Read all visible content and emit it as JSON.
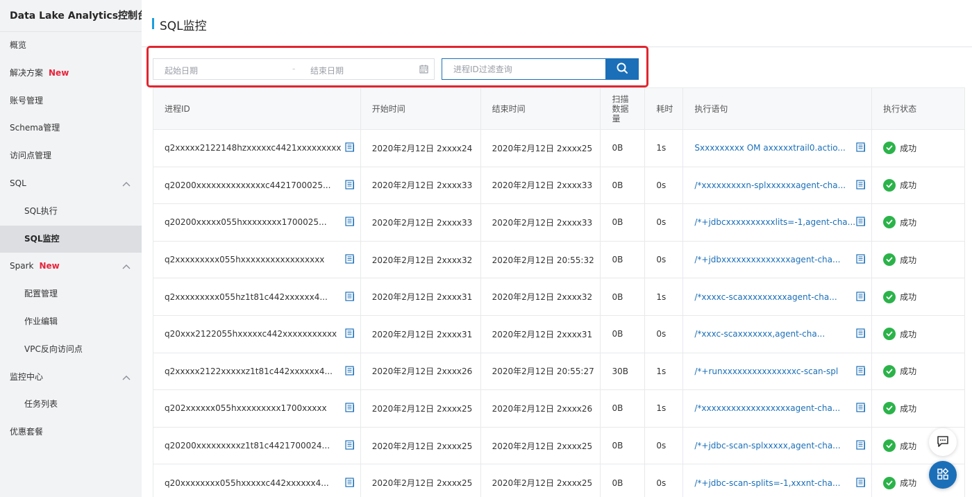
{
  "sidebar": {
    "title": "Data Lake Analytics控制台",
    "items": [
      {
        "label": "概览",
        "new": "",
        "chevron": false
      },
      {
        "label": "解决方案",
        "new": "New",
        "chevron": false
      },
      {
        "label": "账号管理",
        "new": "",
        "chevron": false
      },
      {
        "label": "Schema管理",
        "new": "",
        "chevron": false
      },
      {
        "label": "访问点管理",
        "new": "",
        "chevron": false
      },
      {
        "label": "SQL",
        "new": "",
        "chevron": true
      },
      {
        "label": "SQL执行",
        "new": "",
        "chevron": false,
        "sub": true
      },
      {
        "label": "SQL监控",
        "new": "",
        "chevron": false,
        "sub": true,
        "active": true
      },
      {
        "label": "Spark",
        "new": "New",
        "chevron": true
      },
      {
        "label": "配置管理",
        "new": "",
        "chevron": false,
        "sub": true
      },
      {
        "label": "作业编辑",
        "new": "",
        "chevron": false,
        "sub": true
      },
      {
        "label": "VPC反向访问点",
        "new": "",
        "chevron": false,
        "sub": true
      },
      {
        "label": "监控中心",
        "new": "",
        "chevron": true
      },
      {
        "label": "任务列表",
        "new": "",
        "chevron": false,
        "sub": true
      },
      {
        "label": "优惠套餐",
        "new": "",
        "chevron": false
      }
    ]
  },
  "page": {
    "title": "SQL监控"
  },
  "filters": {
    "start_placeholder": "起始日期",
    "separator": "-",
    "end_placeholder": "结束日期",
    "search_placeholder": "进程ID过滤查询"
  },
  "table": {
    "columns": [
      "进程ID",
      "开始时间",
      "结束时间",
      "扫描数据量",
      "耗时",
      "执行语句",
      "执行状态"
    ],
    "rows": [
      {
        "id": "q2xxxxx2122148hzxxxxxc4421xxxxxxxxx",
        "start": "2020年2月12日 2xxxx24",
        "end": "2020年2月12日 2xxxx25",
        "scan": "0B",
        "dur": "1s",
        "sql": "Sxxxxxxxxx OM axxxxxtrail0.actio...",
        "status": "成功"
      },
      {
        "id": "q20200xxxxxxxxxxxxxxc4421700025...",
        "start": "2020年2月12日 2xxxx33",
        "end": "2020年2月12日 2xxxx33",
        "scan": "0B",
        "dur": "0s",
        "sql": "/*xxxxxxxxxn-splxxxxxxagent-cha...",
        "status": "成功"
      },
      {
        "id": "q20200xxxxx055hxxxxxxxx1700025...",
        "start": "2020年2月12日 2xxxx33",
        "end": "2020年2月12日 2xxxx33",
        "scan": "0B",
        "dur": "0s",
        "sql": "/*+jdbcxxxxxxxxxxlits=-1,agent-cha...",
        "status": "成功"
      },
      {
        "id": "q2xxxxxxxxx055hxxxxxxxxxxxxxxxxx",
        "start": "2020年2月12日 2xxxx32",
        "end": "2020年2月12日 20:55:32",
        "scan": "0B",
        "dur": "0s",
        "sql": "/*+jdbxxxxxxxxxxxxxxagent-cha...",
        "status": "成功"
      },
      {
        "id": "q2xxxxxxxxx055hz1t81c442xxxxxx4...",
        "start": "2020年2月12日 2xxxx31",
        "end": "2020年2月12日 2xxxx32",
        "scan": "0B",
        "dur": "1s",
        "sql": "/*xxxxc-scaxxxxxxxxxagent-cha...",
        "status": "成功"
      },
      {
        "id": "q20xxx2122055hxxxxxc442xxxxxxxxxxx",
        "start": "2020年2月12日 2xxxx31",
        "end": "2020年2月12日 2xxxx31",
        "scan": "0B",
        "dur": "0s",
        "sql": "/*xxxc-scaxxxxxxx,agent-cha...",
        "status": "成功"
      },
      {
        "id": "q2xxxxx2122xxxxxz1t81c442xxxxxx4...",
        "start": "2020年2月12日 2xxxx26",
        "end": "2020年2月12日 20:55:27",
        "scan": "30B",
        "dur": "1s",
        "sql": "/*+runxxxxxxxxxxxxxxxc-scan-spl",
        "status": "成功"
      },
      {
        "id": "q202xxxxxx055hxxxxxxxxx1700xxxxx",
        "start": "2020年2月12日 2xxxx25",
        "end": "2020年2月12日 2xxxx26",
        "scan": "0B",
        "dur": "1s",
        "sql": "/*xxxxxxxxxxxxxxxxxxagent-cha...",
        "status": "成功"
      },
      {
        "id": "q20200xxxxxxxxxz1t81c4421700024...",
        "start": "2020年2月12日 2xxxx25",
        "end": "2020年2月12日 2xxxx25",
        "scan": "0B",
        "dur": "0s",
        "sql": "/*+jdbc-scan-splxxxxx,agent-cha...",
        "status": "成功"
      },
      {
        "id": "q20xxxxxxxx055hxxxxxc442xxxxxx4...",
        "start": "2020年2月12日 2xxxx25",
        "end": "2020年2月12日 2xxxx25",
        "scan": "0B",
        "dur": "0s",
        "sql": "/*+jdbc-scan-splits=-1,xxxnt-cha...",
        "status": "成功"
      }
    ]
  },
  "icons": {
    "search": "search-icon",
    "calendar": "calendar-icon",
    "doc": "document-icon",
    "check": "check-circle-icon",
    "chat": "chat-icon",
    "apps": "apps-icon"
  },
  "colors": {
    "accent": "#1b6fb8",
    "highlight": "#e0262f",
    "success": "#2bb34a",
    "new": "#e8233a"
  }
}
